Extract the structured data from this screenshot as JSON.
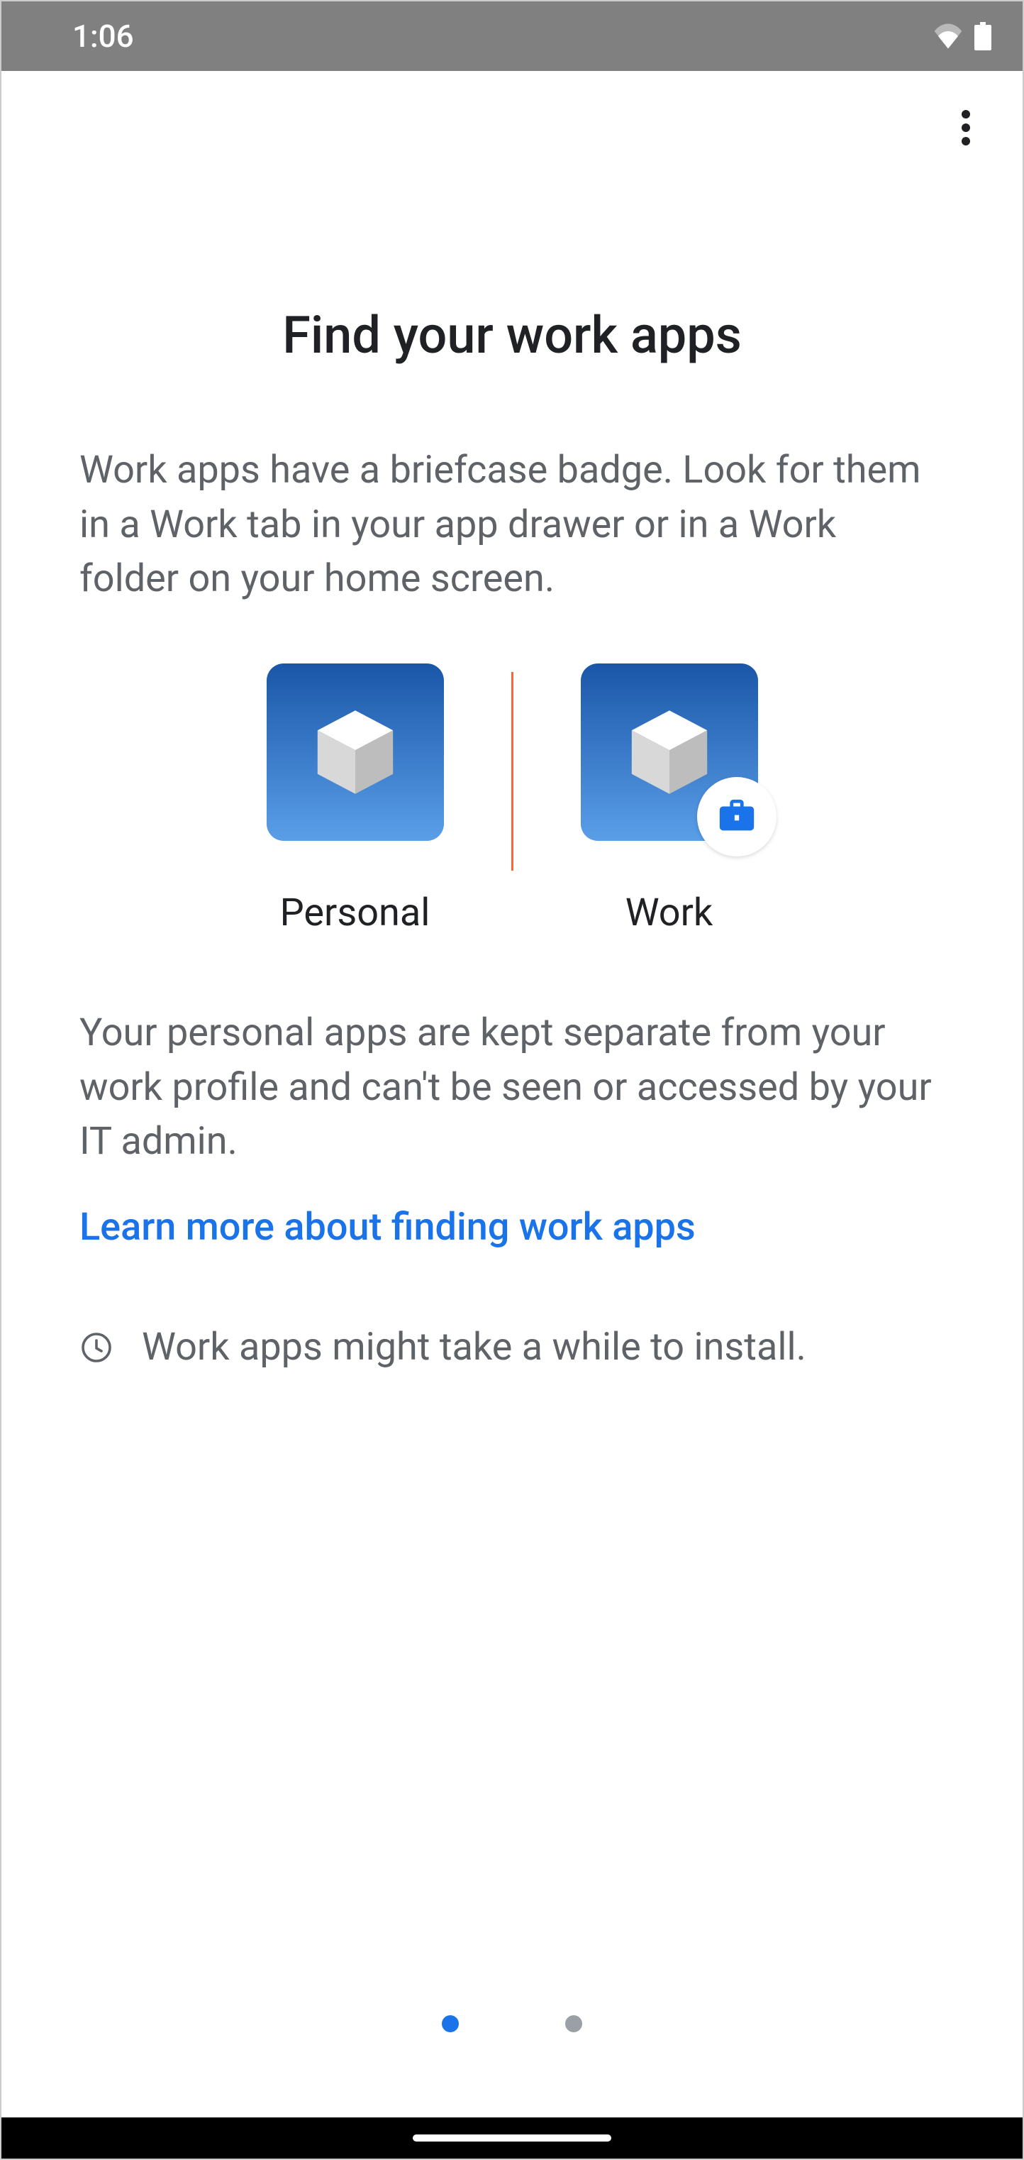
{
  "status": {
    "time": "1:06"
  },
  "page": {
    "title": "Find your work apps",
    "description1": "Work apps have a briefcase badge. Look for them in a Work tab in your app drawer or in a Work folder on your home screen.",
    "personal_label": "Personal",
    "work_label": "Work",
    "description2": "Your personal apps are kept separate from your work profile and can't be seen or accessed by your IT admin.",
    "learn_more": "Learn more about finding work apps",
    "note": "Work apps might take a while to install."
  },
  "pager": {
    "current": 0,
    "total": 2
  }
}
